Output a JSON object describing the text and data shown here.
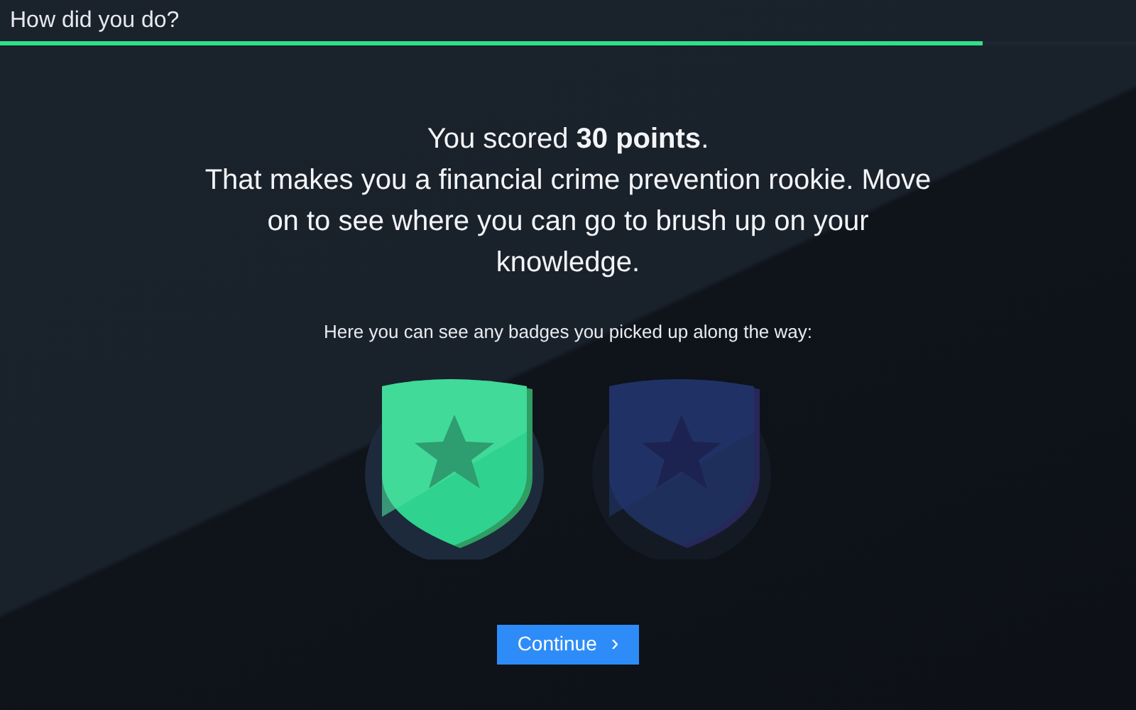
{
  "header": {
    "title": "How did you do?",
    "progress": {
      "level": 0.865
    }
  },
  "result": {
    "score_line": "You scored **30 points**.",
    "message": "That makes you a financial crime prevention rookie. Move on to see where you can go to brush up on your knowledge."
  },
  "badges_intro": "Here you can see any badges you picked up along the way:",
  "badges": [
    {
      "earned": true
    },
    {
      "earned": false
    }
  ],
  "button": {
    "label": "Continue",
    "icon": "›"
  }
}
